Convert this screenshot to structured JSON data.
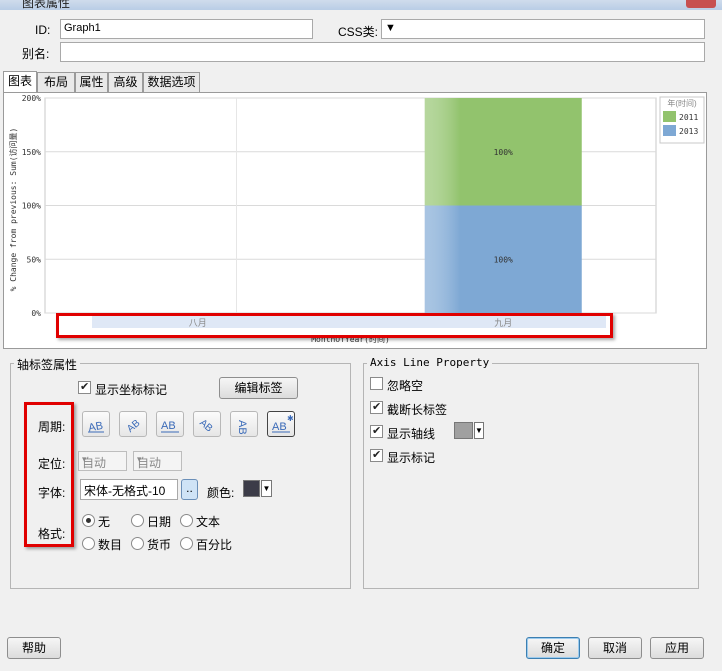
{
  "window": {
    "title": "图表属性"
  },
  "header": {
    "id_label": "ID:",
    "id_value": "Graph1",
    "css_label": "CSS类:",
    "css_value": "",
    "alias_label": "别名:",
    "alias_value": ""
  },
  "tabs": [
    {
      "label": "图表"
    },
    {
      "label": "布局"
    },
    {
      "label": "属性"
    },
    {
      "label": "高级"
    },
    {
      "label": "数据选项"
    }
  ],
  "chart_data": {
    "type": "bar",
    "stacked": true,
    "categories": [
      "八月",
      "九月"
    ],
    "series": [
      {
        "name": "2013",
        "values": [
          0,
          100
        ],
        "color": "#7ea8d4"
      },
      {
        "name": "2011",
        "values": [
          0,
          100
        ],
        "color": "#92c36d"
      }
    ],
    "data_labels": [
      "100%",
      "100%"
    ],
    "ylabel": "% Change from previous: Sum(访问量)",
    "xlabel": "MonthOfYear(时间)",
    "yticks": [
      "200%",
      "150%",
      "100%",
      "50%",
      "0%"
    ],
    "ylim": [
      0,
      200
    ],
    "legend_title": "年(时间)",
    "legend_position": "right",
    "grid": true
  },
  "axis_label_props": {
    "title": "轴标签属性",
    "show_marks_label": "显示坐标标记",
    "show_marks_checked": true,
    "edit_label_button": "编辑标签",
    "cycle_label": "周期:",
    "position_label": "定位:",
    "position_select1": "自动",
    "position_select2": "自动",
    "font_label": "字体:",
    "font_value": "宋体-无格式-10",
    "font_button": "..",
    "color_label": "颜色:",
    "color_value": "#3c3c48",
    "format_label": "格式:",
    "formats": [
      {
        "label": "无",
        "checked": true
      },
      {
        "label": "日期",
        "checked": false
      },
      {
        "label": "文本",
        "checked": false
      },
      {
        "label": "数目",
        "checked": false
      },
      {
        "label": "货币",
        "checked": false
      },
      {
        "label": "百分比",
        "checked": false
      }
    ],
    "icon_buttons": [
      "text-horizontal-icon",
      "text-rotate-45-icon",
      "text-normal-icon",
      "text-rotate-neg45-icon",
      "text-vertical-icon",
      "text-custom-icon"
    ]
  },
  "axis_line_props": {
    "title": "Axis Line Property",
    "ignore_null_label": "忽略空",
    "ignore_null_checked": false,
    "truncate_label": "截断长标签",
    "truncate_checked": true,
    "show_axis_line_label": "显示轴线",
    "show_axis_line_checked": true,
    "axis_line_color": "#a0a0a0",
    "show_marks_label": "显示标记",
    "show_marks_checked": true
  },
  "footer": {
    "help": "帮助",
    "ok": "确定",
    "cancel": "取消",
    "apply": "应用"
  },
  "colors": {
    "highlight": "#e00000"
  }
}
